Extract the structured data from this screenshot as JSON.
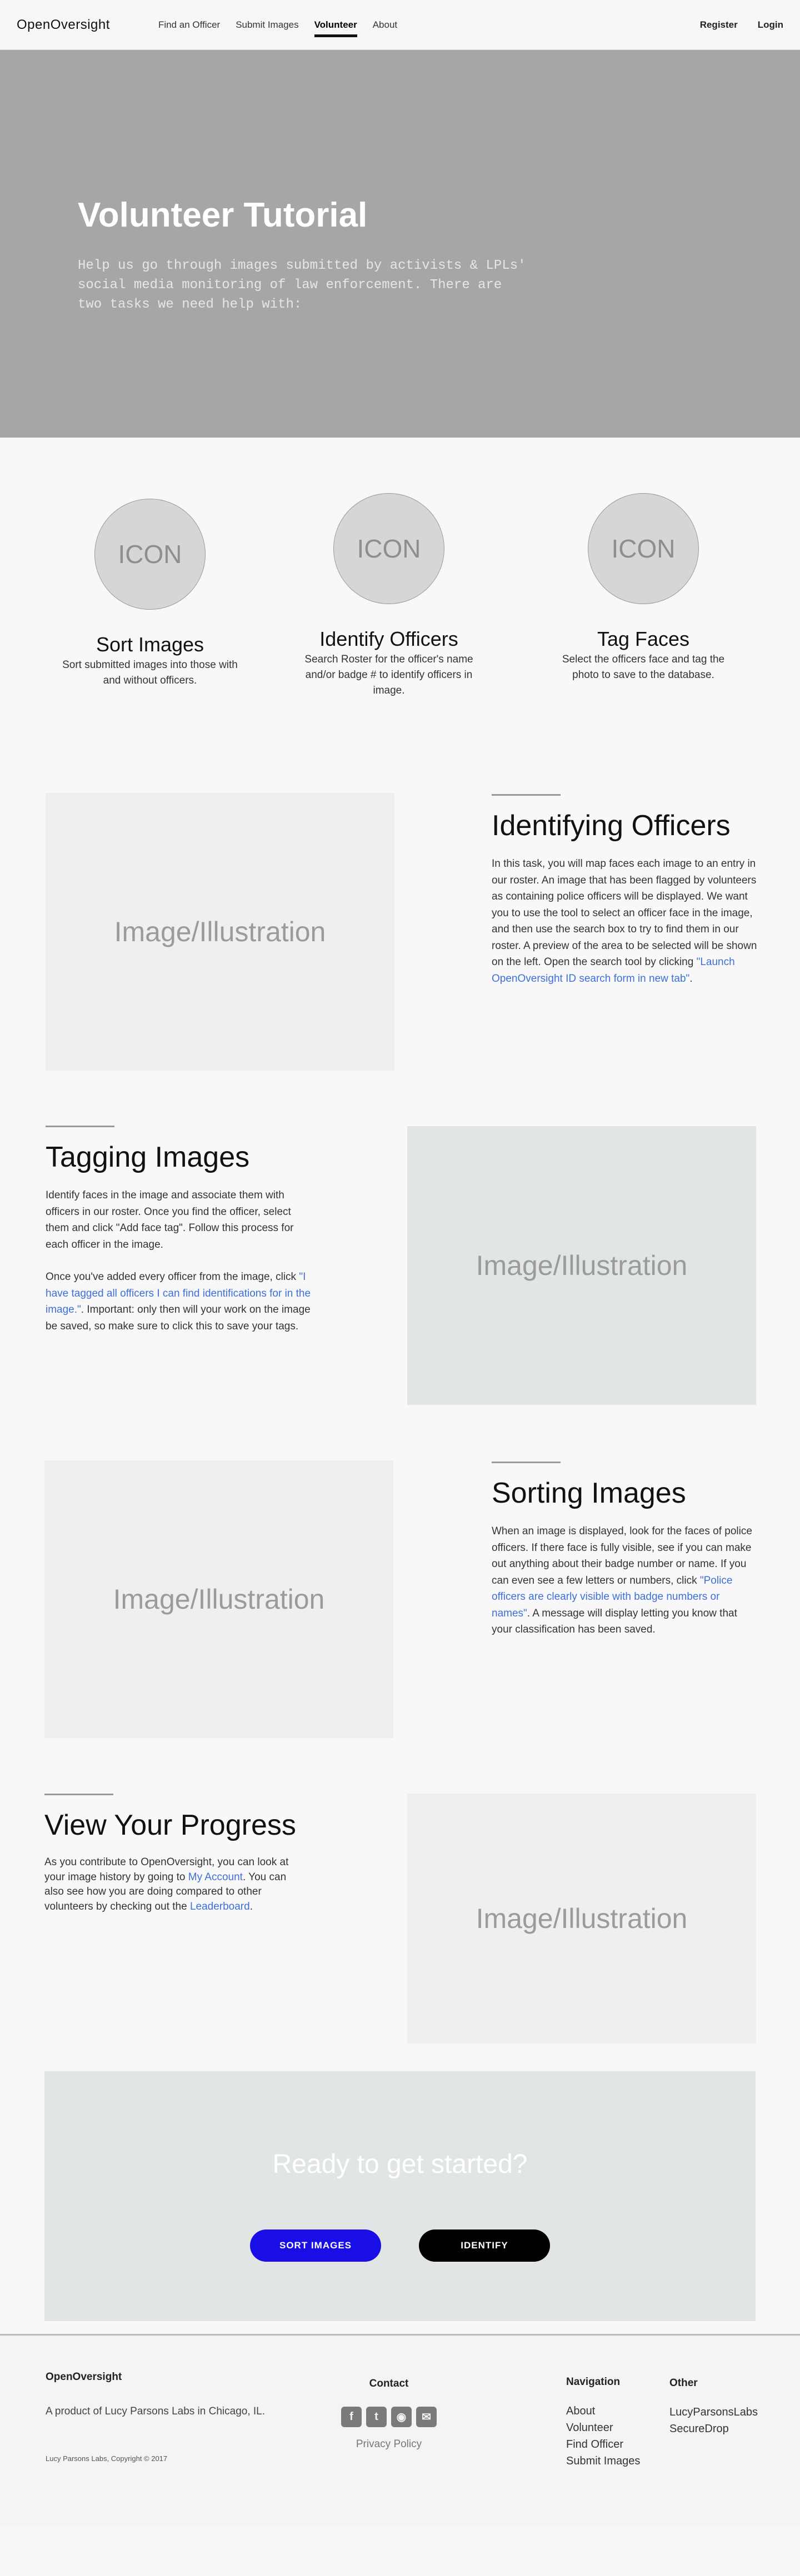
{
  "nav": {
    "brand": "OpenOversight",
    "links": [
      "Find an Officer",
      "Submit Images",
      "Volunteer",
      "About"
    ],
    "register": "Register",
    "login": "Login"
  },
  "hero": {
    "title": "Volunteer Tutorial",
    "subtitle": "Help us go through images submitted by activists & LPLs' social media monitoring of law enforcement. There are two tasks we need help with:"
  },
  "tasks": [
    {
      "icon": "ICON",
      "title": "Sort Images",
      "desc": "Sort submitted images into those with and without officers."
    },
    {
      "icon": "ICON",
      "title": "Identify Officers",
      "desc": "Search Roster for the officer's name and/or badge # to identify officers in image."
    },
    {
      "icon": "ICON",
      "title": "Tag Faces",
      "desc": "Select the officers face and tag the photo to save to the database."
    }
  ],
  "placeholder_label": "Image/Illustration",
  "identifying": {
    "title": "Identifying Officers",
    "body": "In this task, you will map faces each image to an entry in our roster. An image that has been flagged by volunteers as containing police officers will be displayed. We want you to use the tool to select an officer face in the image, and then use the search box to try to find them in our roster. A preview of the area to be selected will be shown on the left. Open the search tool by clicking ",
    "link": "\"Launch OpenOversight ID search form in new tab\"",
    "end": "."
  },
  "tagging": {
    "title": "Tagging Images",
    "body1": "Identify faces in the image and associate them with officers in our roster. Once you find the officer, select them and click \"Add face tag\". Follow this process for each officer in the image.",
    "body2": "Once you've added every officer from the image, click ",
    "link": "\"I have tagged all officers I can find identifications for in the image.\"",
    "end": ". Important: only then will your work on the image be saved, so make sure to click this to save your tags."
  },
  "sorting": {
    "title": "Sorting Images",
    "body": "When an image is displayed, look for the faces of police officers. If there face is fully visible, see if you can make out anything about their badge number or name. If you can even see a few letters or numbers, click ",
    "link": "\"Police officers are clearly visible with badge numbers or names\"",
    "end": ". A message will display letting you know that your classification has been saved."
  },
  "progress": {
    "title": "View Your Progress",
    "body1": "As you contribute to OpenOversight, you can look at your image history by going to ",
    "link1": "My Account",
    "mid": ". You can also see how you are doing compared to other volunteers by checking out the ",
    "link2": "Leaderboard",
    "end": "."
  },
  "cta": {
    "title": "Ready to get started?",
    "sort_button": "SORT IMAGES",
    "identify_button": "IDENTIFY"
  },
  "footer": {
    "brand": "OpenOversight",
    "tagline": "A product of Lucy Parsons Labs in Chicago, IL.",
    "copyright": "Lucy Parsons Labs, Copyright © 2017",
    "contact_title": "Contact",
    "privacy": "Privacy Policy",
    "navigation_title": "Navigation",
    "navigation": [
      "About",
      "Volunteer",
      "Find Officer",
      "Submit Images"
    ],
    "other_title": "Other",
    "other": [
      "LucyParsonsLabs",
      "SecureDrop"
    ]
  },
  "colors": {
    "hero_bg": "#a6a6a6",
    "link": "#3d6fd9",
    "sort_button": "#1a0ee6",
    "identify_button": "#000000"
  }
}
